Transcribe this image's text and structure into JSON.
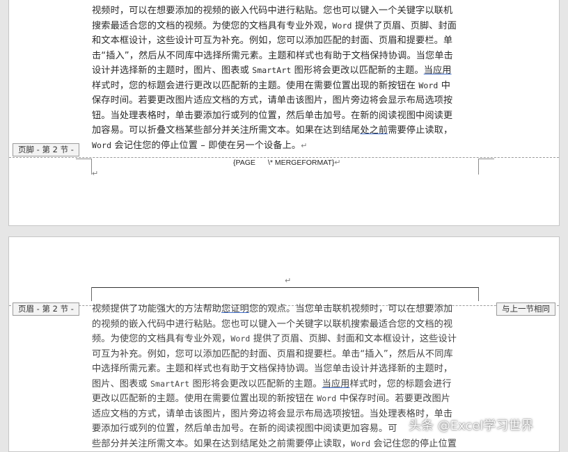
{
  "page1": {
    "lines": [
      [
        "视频时，可以在想要添加的视频的嵌入代码中进行粘贴。您也可以键入一个关键字以联机"
      ],
      [
        "搜索最适合您的文档的视频。为使您的文档具有专业外观，",
        {
          "mono": "Word"
        },
        " 提供了页眉、页脚、封面"
      ],
      [
        "和文本框设计，这些设计可互为补充。例如，您可以添加匹配的封面、页眉和提要栏。单"
      ],
      [
        "击“插入”，然后从不同库中选择所需元素。主题和样式也有助于文档保持协调。当您单击"
      ],
      [
        "设计并选择新的主题时，图片、图表或 ",
        {
          "mono": "SmartArt"
        },
        " 图形将会更改以匹配新的主题。",
        {
          "u": "当应用"
        }
      ],
      [
        "样式时，您的标题会进行更改以匹配新的主题。使用在需要位置出现的新按钮在 ",
        {
          "mono": "Word"
        },
        " 中"
      ],
      [
        "保存时间。若要更改图片适应文档的方式，请单击该图片，图片旁边将会显示布局选项按"
      ],
      [
        "钮。当处理表格时，单击要添加行或列的位置，然后单击加号。在新的阅读视图中阅读更"
      ],
      [
        "加容易。可以折叠文档某些部分并关注所需文本。如果在达到结尾",
        {
          "u": "处之前"
        },
        "需要停止读取，"
      ],
      [
        {
          "mono": "Word"
        },
        " 会记住您的停止位置 – 即使在另一个设备上。",
        {
          "pm": "↵"
        }
      ]
    ],
    "footer_tag": "页脚 - 第 2 节 -",
    "field_code_left": "{PAGE",
    "field_code_right": "\\* MERGEFORMAT}",
    "para_mark": "↵"
  },
  "page2": {
    "header_tag": "页眉 - 第 2 节 -",
    "link_prev": "与上一节相同",
    "para_mark": "↵",
    "lines": [
      [
        "视频提供了功能强大的方法帮助",
        {
          "u": "您证明"
        },
        "您的观点。当您单击联机视频时，可以在想要添加"
      ],
      [
        "的视频的嵌入代码中进行粘贴。您也可以键入一个关键字以联机搜索最适合您的文档的视"
      ],
      [
        "频。为使您的文档具有专业外观，",
        {
          "mono": "Word"
        },
        " 提供了页眉、页脚、封面和文本框设计，这些设计"
      ],
      [
        "可互为补充。例如，您可以添加匹配的封面、页眉和提要栏。单击“插入”，然后从不同库"
      ],
      [
        "中选择所需元素。主题和样式也有助于文档保持协调。当您单击设计并选择新的主题时，"
      ],
      [
        "图片、图表或 ",
        {
          "mono": "SmartArt"
        },
        " 图形将会更改以匹配新的主题。",
        {
          "u": "当应用"
        },
        "样式时，您的标题会进行"
      ],
      [
        "更改以匹配新的主题。使用在需要位置出现的新按钮在 ",
        {
          "mono": "Word"
        },
        " 中保存时间。若要更改图片"
      ],
      [
        "适应文档的方式，请单击该图片，图片旁边将会显示布局选项按钮。当处理表格时，单击"
      ],
      [
        "要添加行或列的位置，然后单击加号。在新的阅读视图中阅读更加容易。可"
      ],
      [
        "些部分并关注所需文本。如果在达到结尾处之前需要停止读取，",
        {
          "mono": "Word"
        },
        " 会记住您的停止位置"
      ]
    ]
  },
  "watermark": "头条 @Excel学习世界"
}
